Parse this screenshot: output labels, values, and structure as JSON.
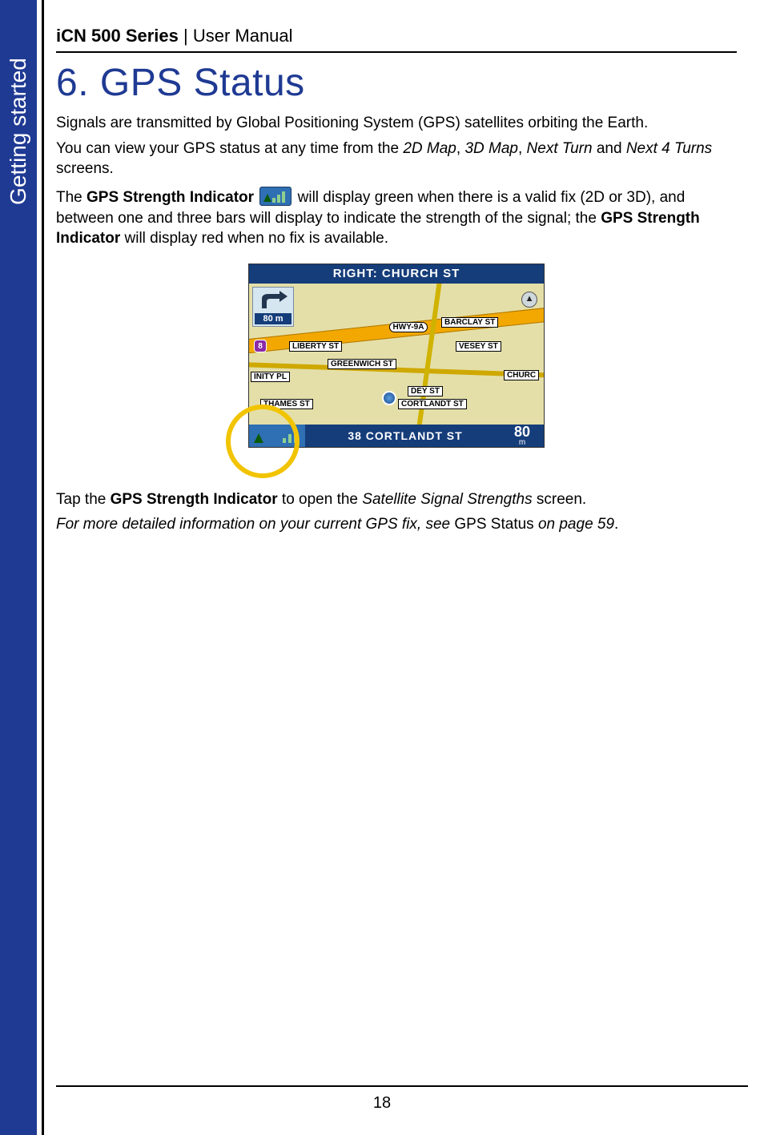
{
  "side_tab": "Getting started",
  "header": {
    "series": "iCN 500 Series",
    "sep": " | ",
    "manual": "User Manual"
  },
  "title": "6. GPS Status",
  "p1": "Signals are transmitted by Global Positioning System (GPS) satellites orbiting the Earth.",
  "p2": {
    "a": "You can view your GPS status at any time from the ",
    "i1": "2D Map",
    "c1": ", ",
    "i2": "3D Map",
    "c2": ", ",
    "i3": "Next Turn",
    "c3": " and ",
    "i4": "Next 4 Turns",
    "b": " screens."
  },
  "p3": {
    "a": "The ",
    "b1": "GPS Strength Indicator",
    "mid": " will display green when there is a valid fix (2D or 3D), and between one and three bars will display to indicate the strength of the signal; the ",
    "b2": "GPS Strength Indicator",
    "end": " will display red when no fix is available."
  },
  "map": {
    "topbar": "RIGHT: CHURCH ST",
    "turn_dist": "80 m",
    "route_badge": "8",
    "hwy_shield": "HWY-9A",
    "labels": {
      "barclay": "BARCLAY ST",
      "liberty": "LIBERTY ST",
      "vesey": "VESEY ST",
      "greenwich": "GREENWICH ST",
      "trinity": "INITY PL",
      "church": "CHURC",
      "dey": "DEY ST",
      "thames": "THAMES ST",
      "cortlandt": "CORTLANDT ST"
    },
    "bottom_addr": "38 CORTLANDT ST",
    "bottom_dist_num": "80",
    "bottom_dist_unit": "m"
  },
  "p4": {
    "a": "Tap the ",
    "b": "GPS Strength Indicator",
    "c": " to open the ",
    "i": "Satellite Signal Strengths",
    "d": " screen."
  },
  "p5": {
    "i1": "For more detailed information on your current GPS fix, see ",
    "n": "GPS Status",
    "i2": " on page 59",
    "dot": "."
  },
  "page_number": "18"
}
